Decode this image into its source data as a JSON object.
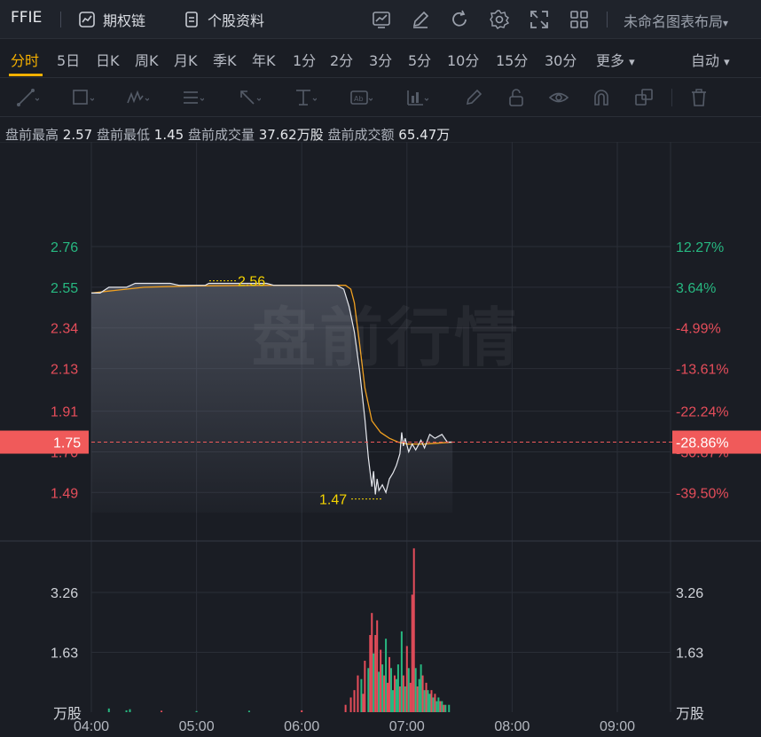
{
  "header": {
    "ticker": "FFIE",
    "options_chain": "期权链",
    "stock_profile": "个股资料",
    "layout_name": "未命名图表布局",
    "icons": [
      "chart-template-icon",
      "draw-pen-icon",
      "refresh-icon",
      "settings-gear-icon",
      "fullscreen-icon",
      "grid-layout-icon"
    ]
  },
  "periods": {
    "items": [
      "分时",
      "5日",
      "日K",
      "周K",
      "月K",
      "季K",
      "年K",
      "1分",
      "2分",
      "3分",
      "5分",
      "10分",
      "15分",
      "30分",
      "更多"
    ],
    "active": "分时",
    "more_arrow": "▾",
    "mode": "自动",
    "mode_arrow": "▾"
  },
  "toolbar": {
    "tools": [
      "trendline-tool-icon",
      "rectangle-tool-icon",
      "pattern-tool-icon",
      "fib-tool-icon",
      "arrow-tool-icon",
      "measure-tool-icon",
      "text-tool-icon",
      "ruler-tool-icon",
      "brush-tool-icon",
      "lock-icon",
      "visibility-icon",
      "magnet-icon",
      "clone-icon",
      "trash-icon"
    ]
  },
  "info": {
    "high_label": "盘前最高",
    "high": "2.57",
    "low_label": "盘前最低",
    "low": "1.45",
    "vol_label": "盘前成交量",
    "vol": "37.62万股",
    "amt_label": "盘前成交额",
    "amt": "65.47万"
  },
  "watermark": "盘前行情",
  "colors": {
    "up": "#27b881",
    "down": "#e54d5a",
    "price_line": "#e6e8ee",
    "avg_line": "#f0a020",
    "highlight": "#f05a5a",
    "annotation": "#f5d300",
    "grid": "#2a2e37"
  },
  "chart_data": {
    "type": "line",
    "x_axis": {
      "ticks": [
        "04:00",
        "05:00",
        "06:00",
        "07:00",
        "08:00",
        "09:00"
      ]
    },
    "price_axis_left": [
      "2.76",
      "2.55",
      "2.34",
      "2.13",
      "1.91",
      "1.70",
      "1.49"
    ],
    "pct_axis_right": [
      "12.27%",
      "3.64%",
      "-4.99%",
      "-13.61%",
      "-22.24%",
      "-30.87%",
      "-39.50%"
    ],
    "ylim": [
      1.386,
      2.87
    ],
    "reference_price": 2.44,
    "current_price": "1.75",
    "current_pct": "-28.86%",
    "annotations": {
      "high": "2.56",
      "low": "1.47"
    },
    "series": [
      {
        "name": "price",
        "points": [
          [
            "04:00",
            2.52
          ],
          [
            "04:05",
            2.52
          ],
          [
            "04:10",
            2.55
          ],
          [
            "04:20",
            2.55
          ],
          [
            "04:25",
            2.57
          ],
          [
            "04:45",
            2.57
          ],
          [
            "04:50",
            2.56
          ],
          [
            "05:05",
            2.56
          ],
          [
            "05:07",
            2.57
          ],
          [
            "05:40",
            2.57
          ],
          [
            "05:44",
            2.56
          ],
          [
            "06:20",
            2.56
          ],
          [
            "06:24",
            2.54
          ],
          [
            "06:27",
            2.45
          ],
          [
            "06:30",
            2.32
          ],
          [
            "06:33",
            2.12
          ],
          [
            "06:36",
            1.87
          ],
          [
            "06:38",
            1.67
          ],
          [
            "06:40",
            1.52
          ],
          [
            "06:41",
            1.6
          ],
          [
            "06:42",
            1.48
          ],
          [
            "06:43",
            1.56
          ],
          [
            "06:44",
            1.5
          ],
          [
            "06:46",
            1.53
          ],
          [
            "06:48",
            1.49
          ],
          [
            "06:50",
            1.56
          ],
          [
            "06:52",
            1.59
          ],
          [
            "06:54",
            1.63
          ],
          [
            "06:56",
            1.69
          ],
          [
            "06:57",
            1.8
          ],
          [
            "06:58",
            1.73
          ],
          [
            "06:59",
            1.77
          ],
          [
            "07:01",
            1.7
          ],
          [
            "07:03",
            1.74
          ],
          [
            "07:05",
            1.71
          ],
          [
            "07:08",
            1.76
          ],
          [
            "07:10",
            1.72
          ],
          [
            "07:13",
            1.79
          ],
          [
            "07:16",
            1.77
          ],
          [
            "07:20",
            1.79
          ],
          [
            "07:23",
            1.75
          ],
          [
            "07:26",
            1.75
          ]
        ]
      },
      {
        "name": "average",
        "points": [
          [
            "04:00",
            2.52
          ],
          [
            "04:10",
            2.53
          ],
          [
            "04:30",
            2.55
          ],
          [
            "05:00",
            2.557
          ],
          [
            "05:40",
            2.56
          ],
          [
            "06:25",
            2.56
          ],
          [
            "06:28",
            2.54
          ],
          [
            "06:30",
            2.47
          ],
          [
            "06:33",
            2.26
          ],
          [
            "06:36",
            2.03
          ],
          [
            "06:40",
            1.86
          ],
          [
            "06:45",
            1.8
          ],
          [
            "06:50",
            1.77
          ],
          [
            "06:55",
            1.75
          ],
          [
            "07:00",
            1.74
          ],
          [
            "07:10",
            1.74
          ],
          [
            "07:26",
            1.75
          ]
        ]
      }
    ],
    "volume": {
      "unit": "万股",
      "axis_ticks_left": [
        "3.26",
        "1.63"
      ],
      "axis_ticks_right": [
        "3.26",
        "1.63"
      ],
      "ylim": [
        0,
        4.66
      ],
      "bars": [
        [
          "04:10",
          0.1,
          "up"
        ],
        [
          "04:20",
          0.05,
          "up"
        ],
        [
          "04:22",
          0.08,
          "up"
        ],
        [
          "04:40",
          0.04,
          "down"
        ],
        [
          "05:00",
          0.03,
          "up"
        ],
        [
          "05:30",
          0.04,
          "up"
        ],
        [
          "06:00",
          0.05,
          "down"
        ],
        [
          "06:25",
          0.2,
          "down"
        ],
        [
          "06:28",
          0.4,
          "down"
        ],
        [
          "06:30",
          0.6,
          "down"
        ],
        [
          "06:32",
          1.0,
          "down"
        ],
        [
          "06:34",
          0.9,
          "up"
        ],
        [
          "06:35",
          0.5,
          "down"
        ],
        [
          "06:36",
          1.4,
          "down"
        ],
        [
          "06:38",
          1.2,
          "up"
        ],
        [
          "06:39",
          2.1,
          "down"
        ],
        [
          "06:40",
          2.7,
          "down"
        ],
        [
          "06:41",
          1.6,
          "up"
        ],
        [
          "06:42",
          2.1,
          "down"
        ],
        [
          "06:43",
          2.5,
          "down"
        ],
        [
          "06:44",
          1.1,
          "up"
        ],
        [
          "06:45",
          1.7,
          "down"
        ],
        [
          "06:46",
          1.3,
          "up"
        ],
        [
          "06:47",
          1.0,
          "down"
        ],
        [
          "06:48",
          2.0,
          "up"
        ],
        [
          "06:49",
          0.8,
          "down"
        ],
        [
          "06:50",
          1.5,
          "down"
        ],
        [
          "06:51",
          1.2,
          "up"
        ],
        [
          "06:52",
          0.6,
          "up"
        ],
        [
          "06:53",
          1.0,
          "down"
        ],
        [
          "06:54",
          0.9,
          "up"
        ],
        [
          "06:55",
          1.3,
          "up"
        ],
        [
          "06:56",
          0.7,
          "down"
        ],
        [
          "06:57",
          2.2,
          "up"
        ],
        [
          "06:58",
          1.0,
          "down"
        ],
        [
          "06:59",
          0.7,
          "up"
        ],
        [
          "07:00",
          1.8,
          "down"
        ],
        [
          "07:01",
          1.2,
          "up"
        ],
        [
          "07:02",
          0.8,
          "down"
        ],
        [
          "07:03",
          3.2,
          "down"
        ],
        [
          "07:04",
          4.46,
          "down"
        ],
        [
          "07:05",
          1.2,
          "up"
        ],
        [
          "07:06",
          0.7,
          "down"
        ],
        [
          "07:07",
          0.9,
          "up"
        ],
        [
          "07:08",
          1.3,
          "up"
        ],
        [
          "07:09",
          1.0,
          "down"
        ],
        [
          "07:10",
          0.6,
          "up"
        ],
        [
          "07:11",
          0.8,
          "down"
        ],
        [
          "07:12",
          0.6,
          "up"
        ],
        [
          "07:13",
          0.5,
          "up"
        ],
        [
          "07:14",
          0.6,
          "down"
        ],
        [
          "07:15",
          0.4,
          "up"
        ],
        [
          "07:16",
          0.5,
          "down"
        ],
        [
          "07:17",
          0.3,
          "up"
        ],
        [
          "07:18",
          0.4,
          "up"
        ],
        [
          "07:19",
          0.3,
          "down"
        ],
        [
          "07:20",
          0.3,
          "up"
        ],
        [
          "07:21",
          0.2,
          "down"
        ],
        [
          "07:22",
          0.2,
          "up"
        ],
        [
          "07:24",
          0.2,
          "up"
        ]
      ]
    },
    "grid": true
  }
}
